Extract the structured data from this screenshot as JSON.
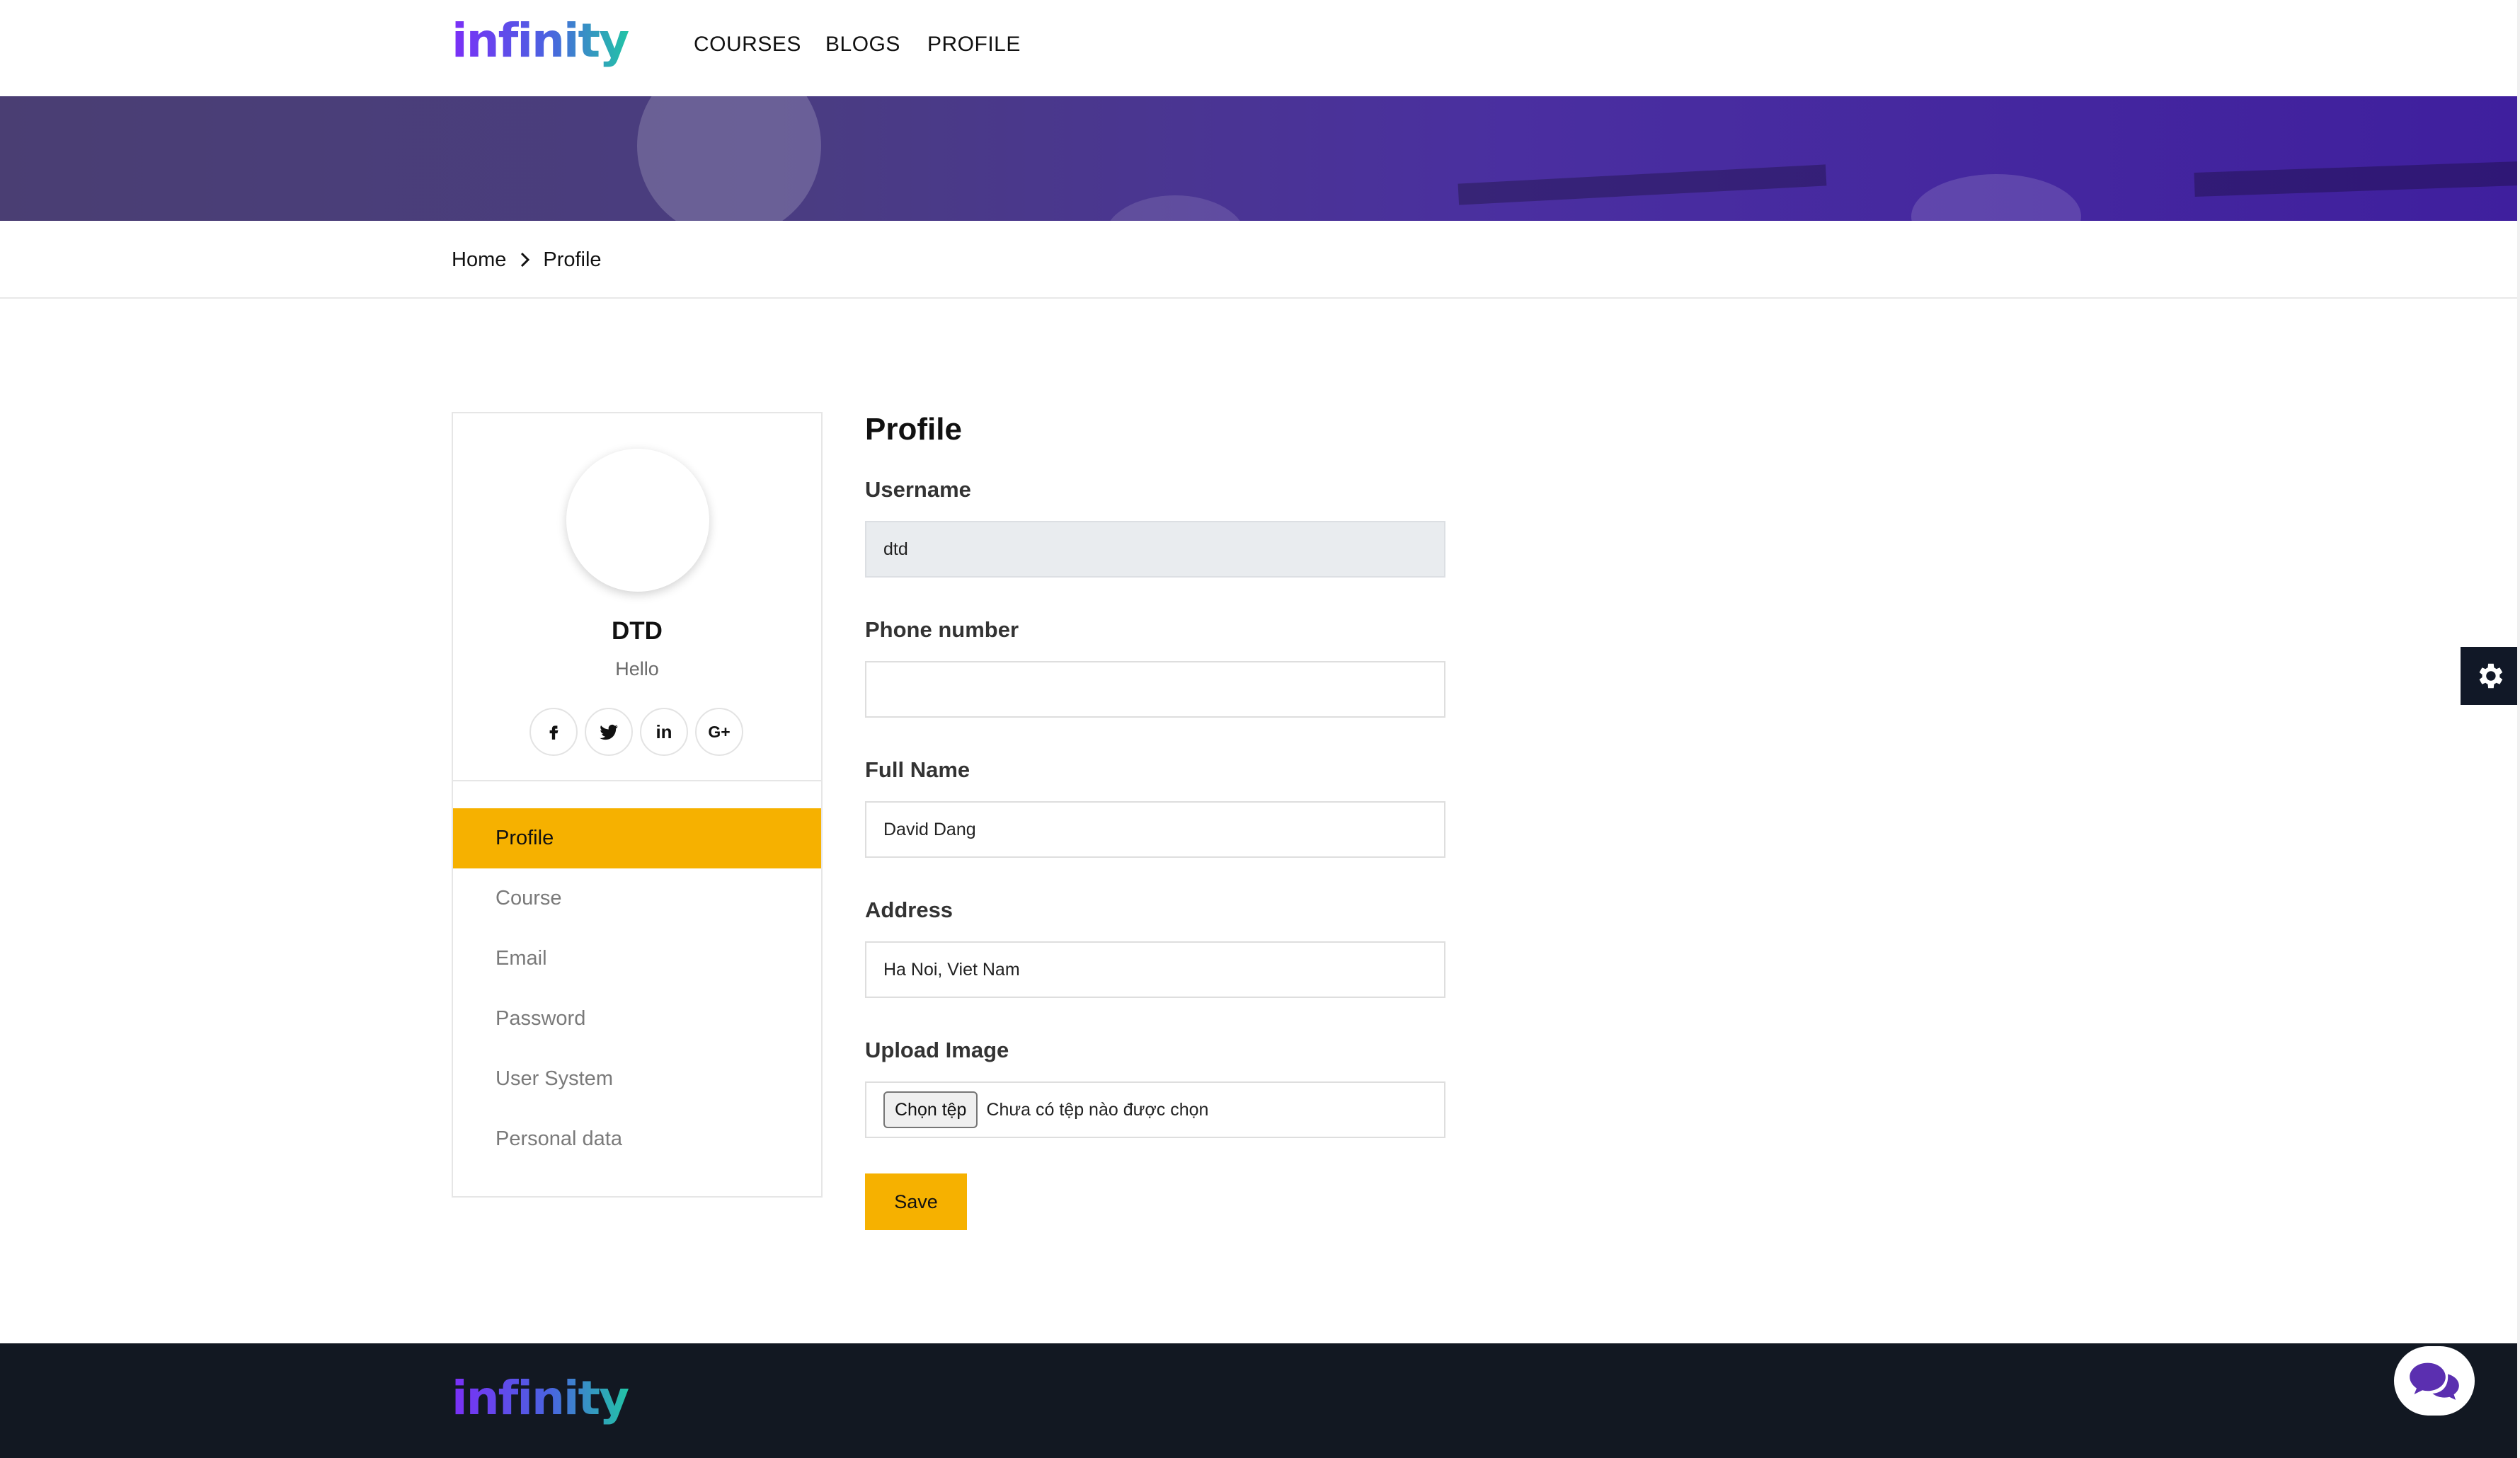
{
  "header": {
    "logo_text": "infinity",
    "nav": [
      {
        "label": "COURSES"
      },
      {
        "label": "BLOGS"
      },
      {
        "label": "PROFILE"
      }
    ]
  },
  "breadcrumb": {
    "home": "Home",
    "current": "Profile"
  },
  "profile_card": {
    "name": "DTD",
    "bio": "Hello",
    "socials": [
      {
        "icon": "facebook-icon",
        "glyph": "f"
      },
      {
        "icon": "twitter-icon",
        "glyph": ""
      },
      {
        "icon": "linkedin-icon",
        "glyph": "in"
      },
      {
        "icon": "google-plus-icon",
        "glyph": "G+"
      }
    ],
    "menu": [
      {
        "label": "Profile",
        "active": true
      },
      {
        "label": "Course",
        "active": false
      },
      {
        "label": "Email",
        "active": false
      },
      {
        "label": "Password",
        "active": false
      },
      {
        "label": "User System",
        "active": false
      },
      {
        "label": "Personal data",
        "active": false
      }
    ]
  },
  "form": {
    "title": "Profile",
    "username": {
      "label": "Username",
      "value": "dtd"
    },
    "phone": {
      "label": "Phone number",
      "value": ""
    },
    "fullname": {
      "label": "Full Name",
      "value": "David Dang"
    },
    "address": {
      "label": "Address",
      "value": "Ha Noi, Viet Nam"
    },
    "upload": {
      "label": "Upload Image",
      "button": "Chọn tệp",
      "status": "Chưa có tệp nào được chọn"
    },
    "save_label": "Save"
  },
  "footer": {
    "logo_text": "infinity"
  },
  "colors": {
    "accent": "#f6b100",
    "footer_bg": "#121822",
    "logo_gradient": [
      "#7b2ff7",
      "#2ec4b6"
    ]
  }
}
